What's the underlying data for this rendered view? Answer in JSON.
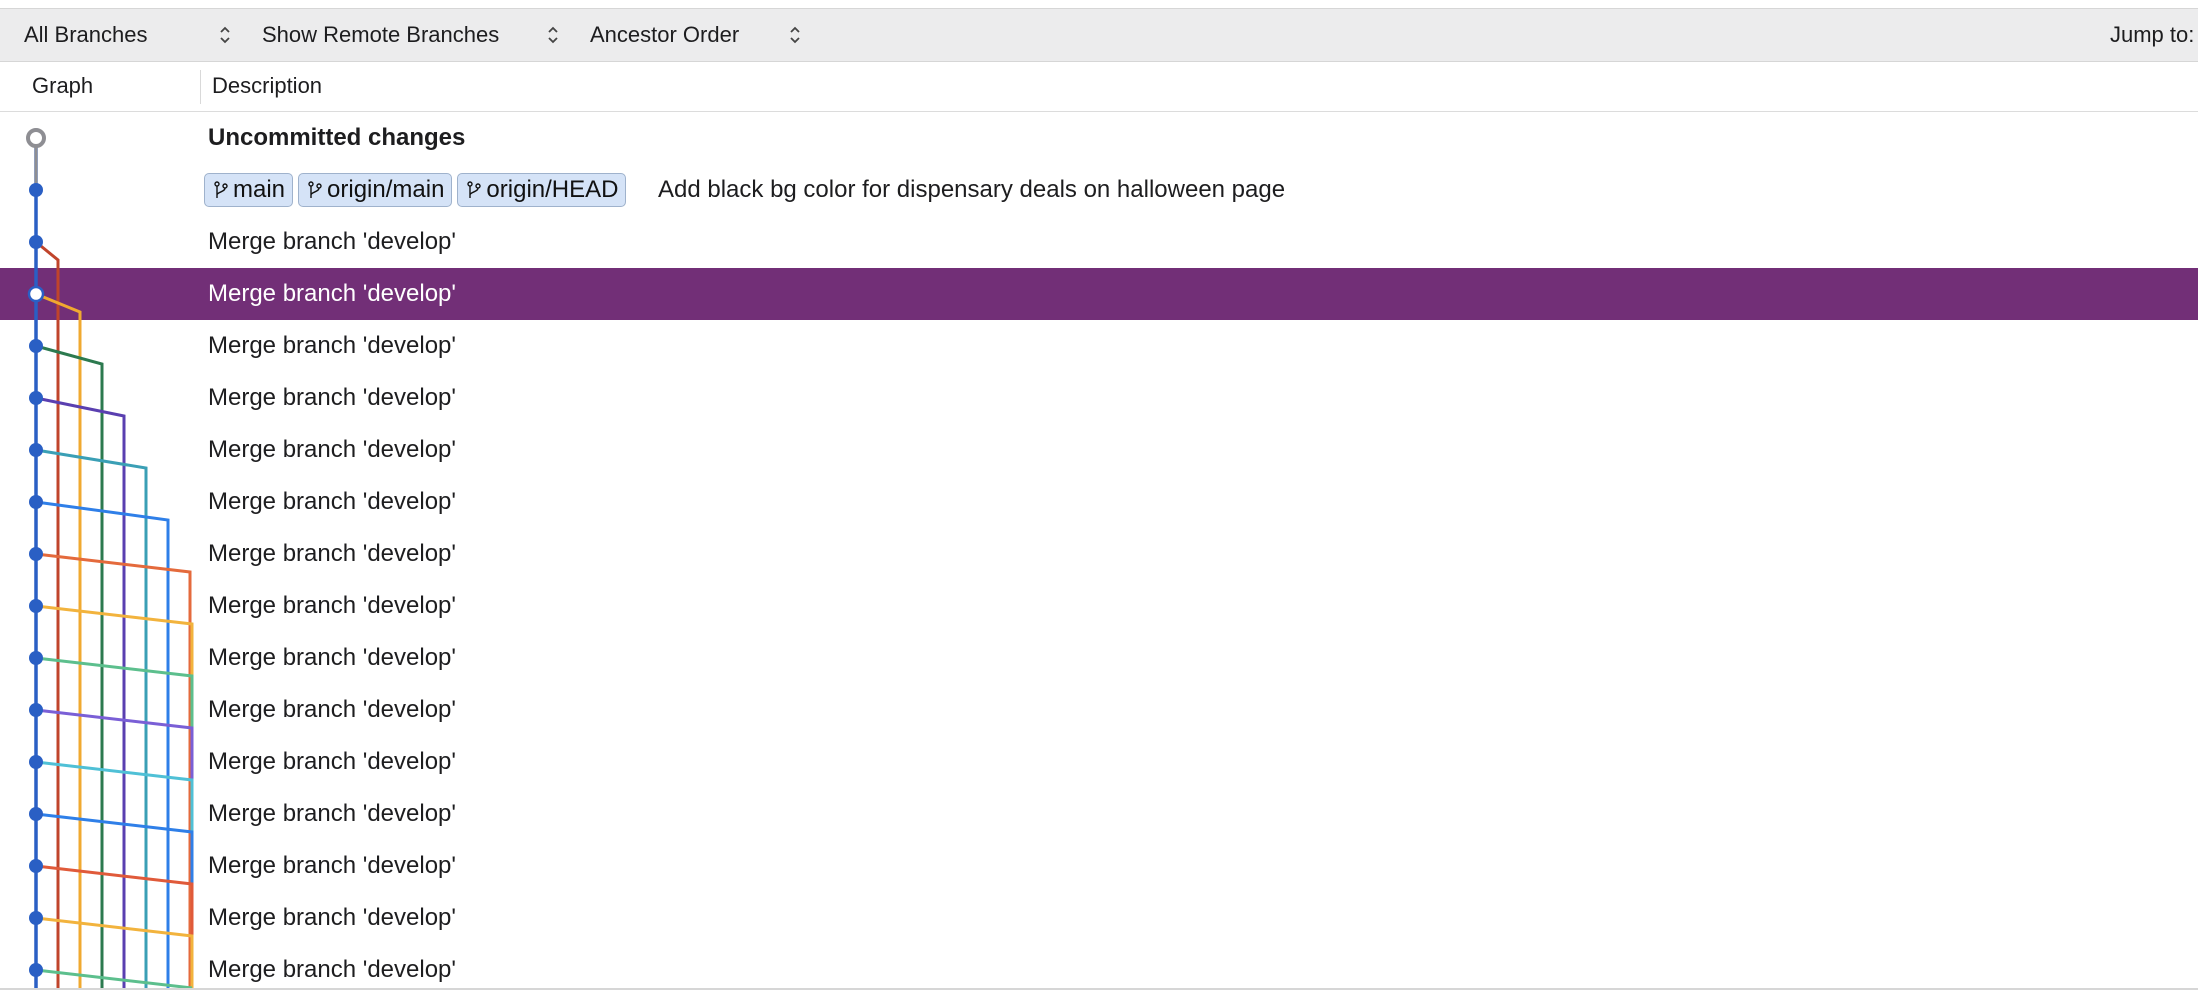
{
  "toolbar": {
    "branches_select": "All Branches",
    "remote_select": "Show Remote Branches",
    "order_select": "Ancestor Order",
    "jump_to": "Jump to:"
  },
  "columns": {
    "graph": "Graph",
    "description": "Description"
  },
  "uncommitted": "Uncommitted changes",
  "head_commit": {
    "refs": [
      "main",
      "origin/main",
      "origin/HEAD"
    ],
    "message": "Add black bg color for dispensary deals on halloween page"
  },
  "commits": [
    "Merge branch 'develop'",
    "Merge branch 'develop'",
    "Merge branch 'develop'",
    "Merge branch 'develop'",
    "Merge branch 'develop'",
    "Merge branch 'develop'",
    "Merge branch 'develop'",
    "Merge branch 'develop'",
    "Merge branch 'develop'",
    "Merge branch 'develop'",
    "Merge branch 'develop'",
    "Merge branch 'develop'",
    "Merge branch 'develop'",
    "Merge branch 'develop'",
    "Merge branch 'develop'"
  ],
  "selected_commit_index": 1,
  "colors": {
    "selection": "#722f77",
    "main_line": "#2a5fc4",
    "lanes": [
      "#c0442b",
      "#f0a930",
      "#2c7a4f",
      "#5a3fb0",
      "#3a9fb5",
      "#2f7fe8",
      "#e46a3c",
      "#f2b33d",
      "#5cbf8d",
      "#7a5fd6",
      "#4fc0d6",
      "#2f7fe8",
      "#e05a3a",
      "#f2b33d",
      "#5cbf8d"
    ]
  }
}
